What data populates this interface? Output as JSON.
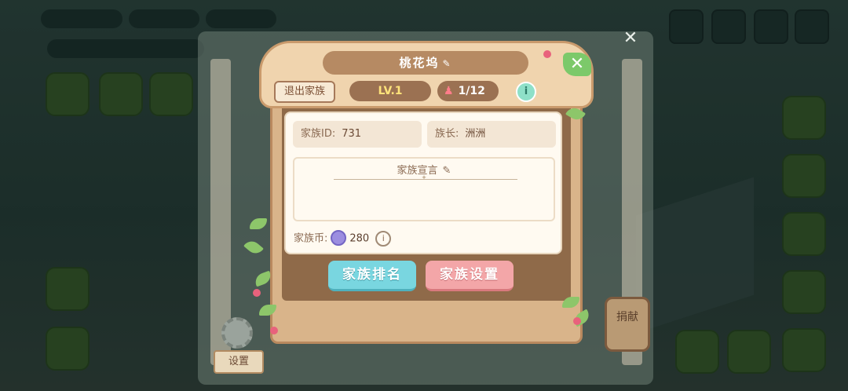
{
  "dialog": {
    "title": "桃花坞",
    "quit_label": "退出家族",
    "level": "LV.1",
    "members": "1/12",
    "family_id_label": "家族ID:",
    "family_id_value": "731",
    "leader_label": "族长:",
    "leader_value": "洲洲",
    "declaration_title": "家族宣言",
    "declaration_text": "",
    "coin_label": "家族币:",
    "coin_value": "280",
    "ranking_button": "家族排名",
    "settings_button": "家族设置"
  },
  "outside": {
    "settings_label": "设置",
    "donate_label": "捐献"
  },
  "colors": {
    "accent_blue": "#79d6e0",
    "accent_pink": "#f3a6a8",
    "wood": "#d9b48a",
    "level_text": "#ffe37a"
  }
}
